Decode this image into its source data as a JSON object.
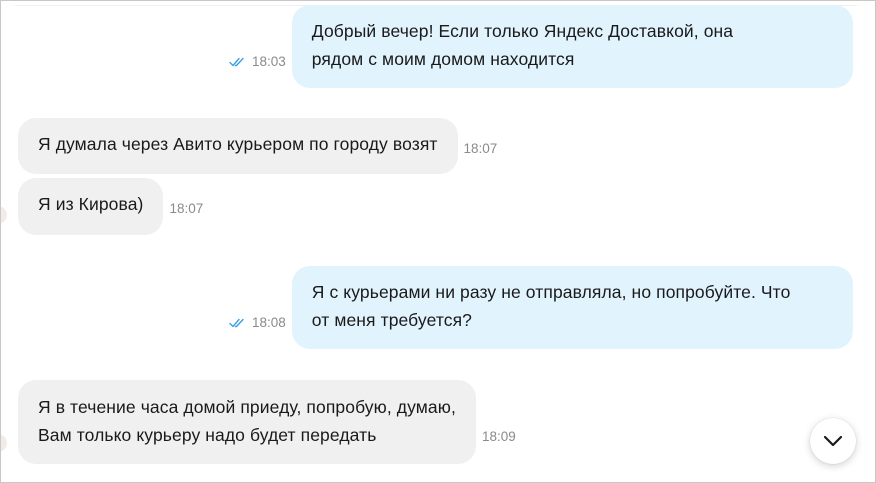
{
  "messages": [
    {
      "direction": "out",
      "lines": [
        "Добрый вечер! Если только Яндекс Доставкой, она",
        "рядом с моим домом находится"
      ],
      "time": "18:03",
      "status": "read"
    },
    {
      "direction": "in",
      "lines": [
        "Я думала через Авито курьером по городу возят"
      ],
      "time": "18:07"
    },
    {
      "direction": "in",
      "lines": [
        "Я из Кирова)"
      ],
      "time": "18:07"
    },
    {
      "direction": "out",
      "lines": [
        "Я с курьерами ни разу не отправляла, но попробуйте. Что",
        "от меня требуется?"
      ],
      "time": "18:08",
      "status": "read"
    },
    {
      "direction": "in",
      "lines": [
        "Я в течение часа домой приеду, попробую, думаю,",
        "Вам только курьеру надо будет передать"
      ],
      "time": "18:09"
    }
  ],
  "icons": {
    "read_receipt": "double-check-icon",
    "scroll_down": "chevron-down-icon"
  },
  "colors": {
    "outgoing_bubble": "#e1f3fd",
    "incoming_bubble": "#f0f0f0",
    "read_check": "#3aa0e6",
    "timestamp": "#8a8a8a"
  }
}
